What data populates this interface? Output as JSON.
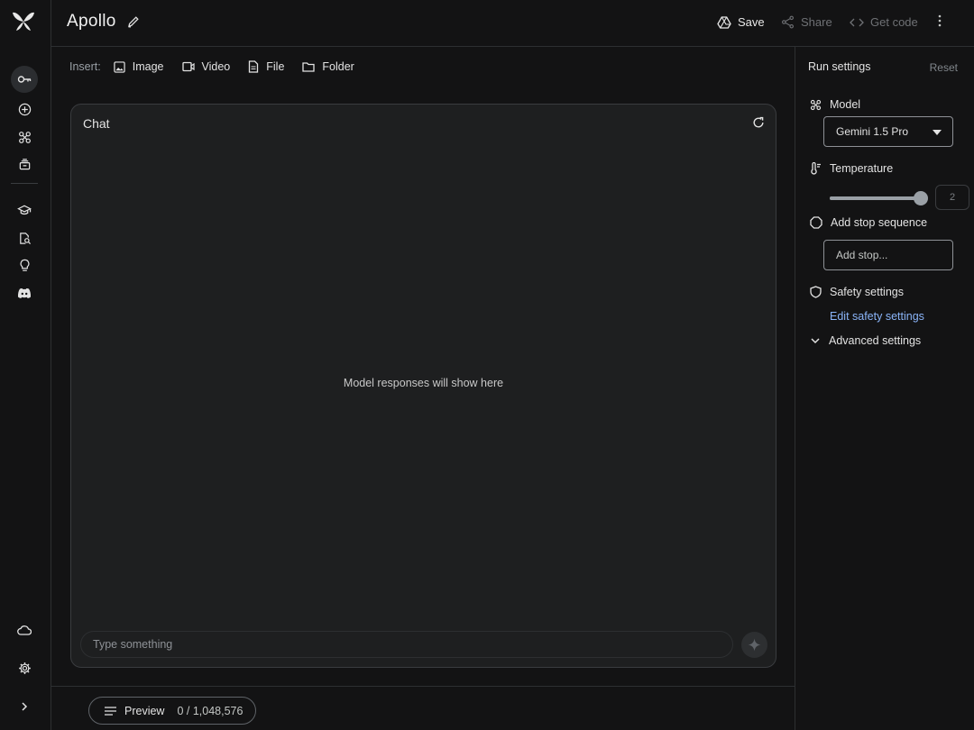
{
  "app": {
    "title": "Apollo"
  },
  "header": {
    "save_label": "Save",
    "share_label": "Share",
    "code_label": "Get code"
  },
  "insert": {
    "label": "Insert:",
    "items": [
      {
        "label": "Image",
        "icon": "image-icon"
      },
      {
        "label": "Video",
        "icon": "video-icon"
      },
      {
        "label": "File",
        "icon": "file-icon"
      },
      {
        "label": "Folder",
        "icon": "folder-icon"
      }
    ]
  },
  "chat": {
    "title": "Chat",
    "empty_message": "Model responses will show here",
    "input_placeholder": "Type something"
  },
  "footer": {
    "preview_label": "Preview",
    "token_count": "0 / 1,048,576"
  },
  "run_settings": {
    "title": "Run settings",
    "reset_label": "Reset",
    "model_label": "Model",
    "model_value": "Gemini 1.5 Pro",
    "temperature_label": "Temperature",
    "temperature_value": "2",
    "temperature_fraction": 1.0,
    "stop_label": "Add stop sequence",
    "stop_placeholder": "Add stop...",
    "safety_label": "Safety settings",
    "safety_link": "Edit safety settings",
    "advanced_label": "Advanced settings"
  },
  "colors": {
    "background": "#131314",
    "panel": "#1e1f20",
    "link": "#8ab4f8",
    "border": "#3a3c3f"
  }
}
